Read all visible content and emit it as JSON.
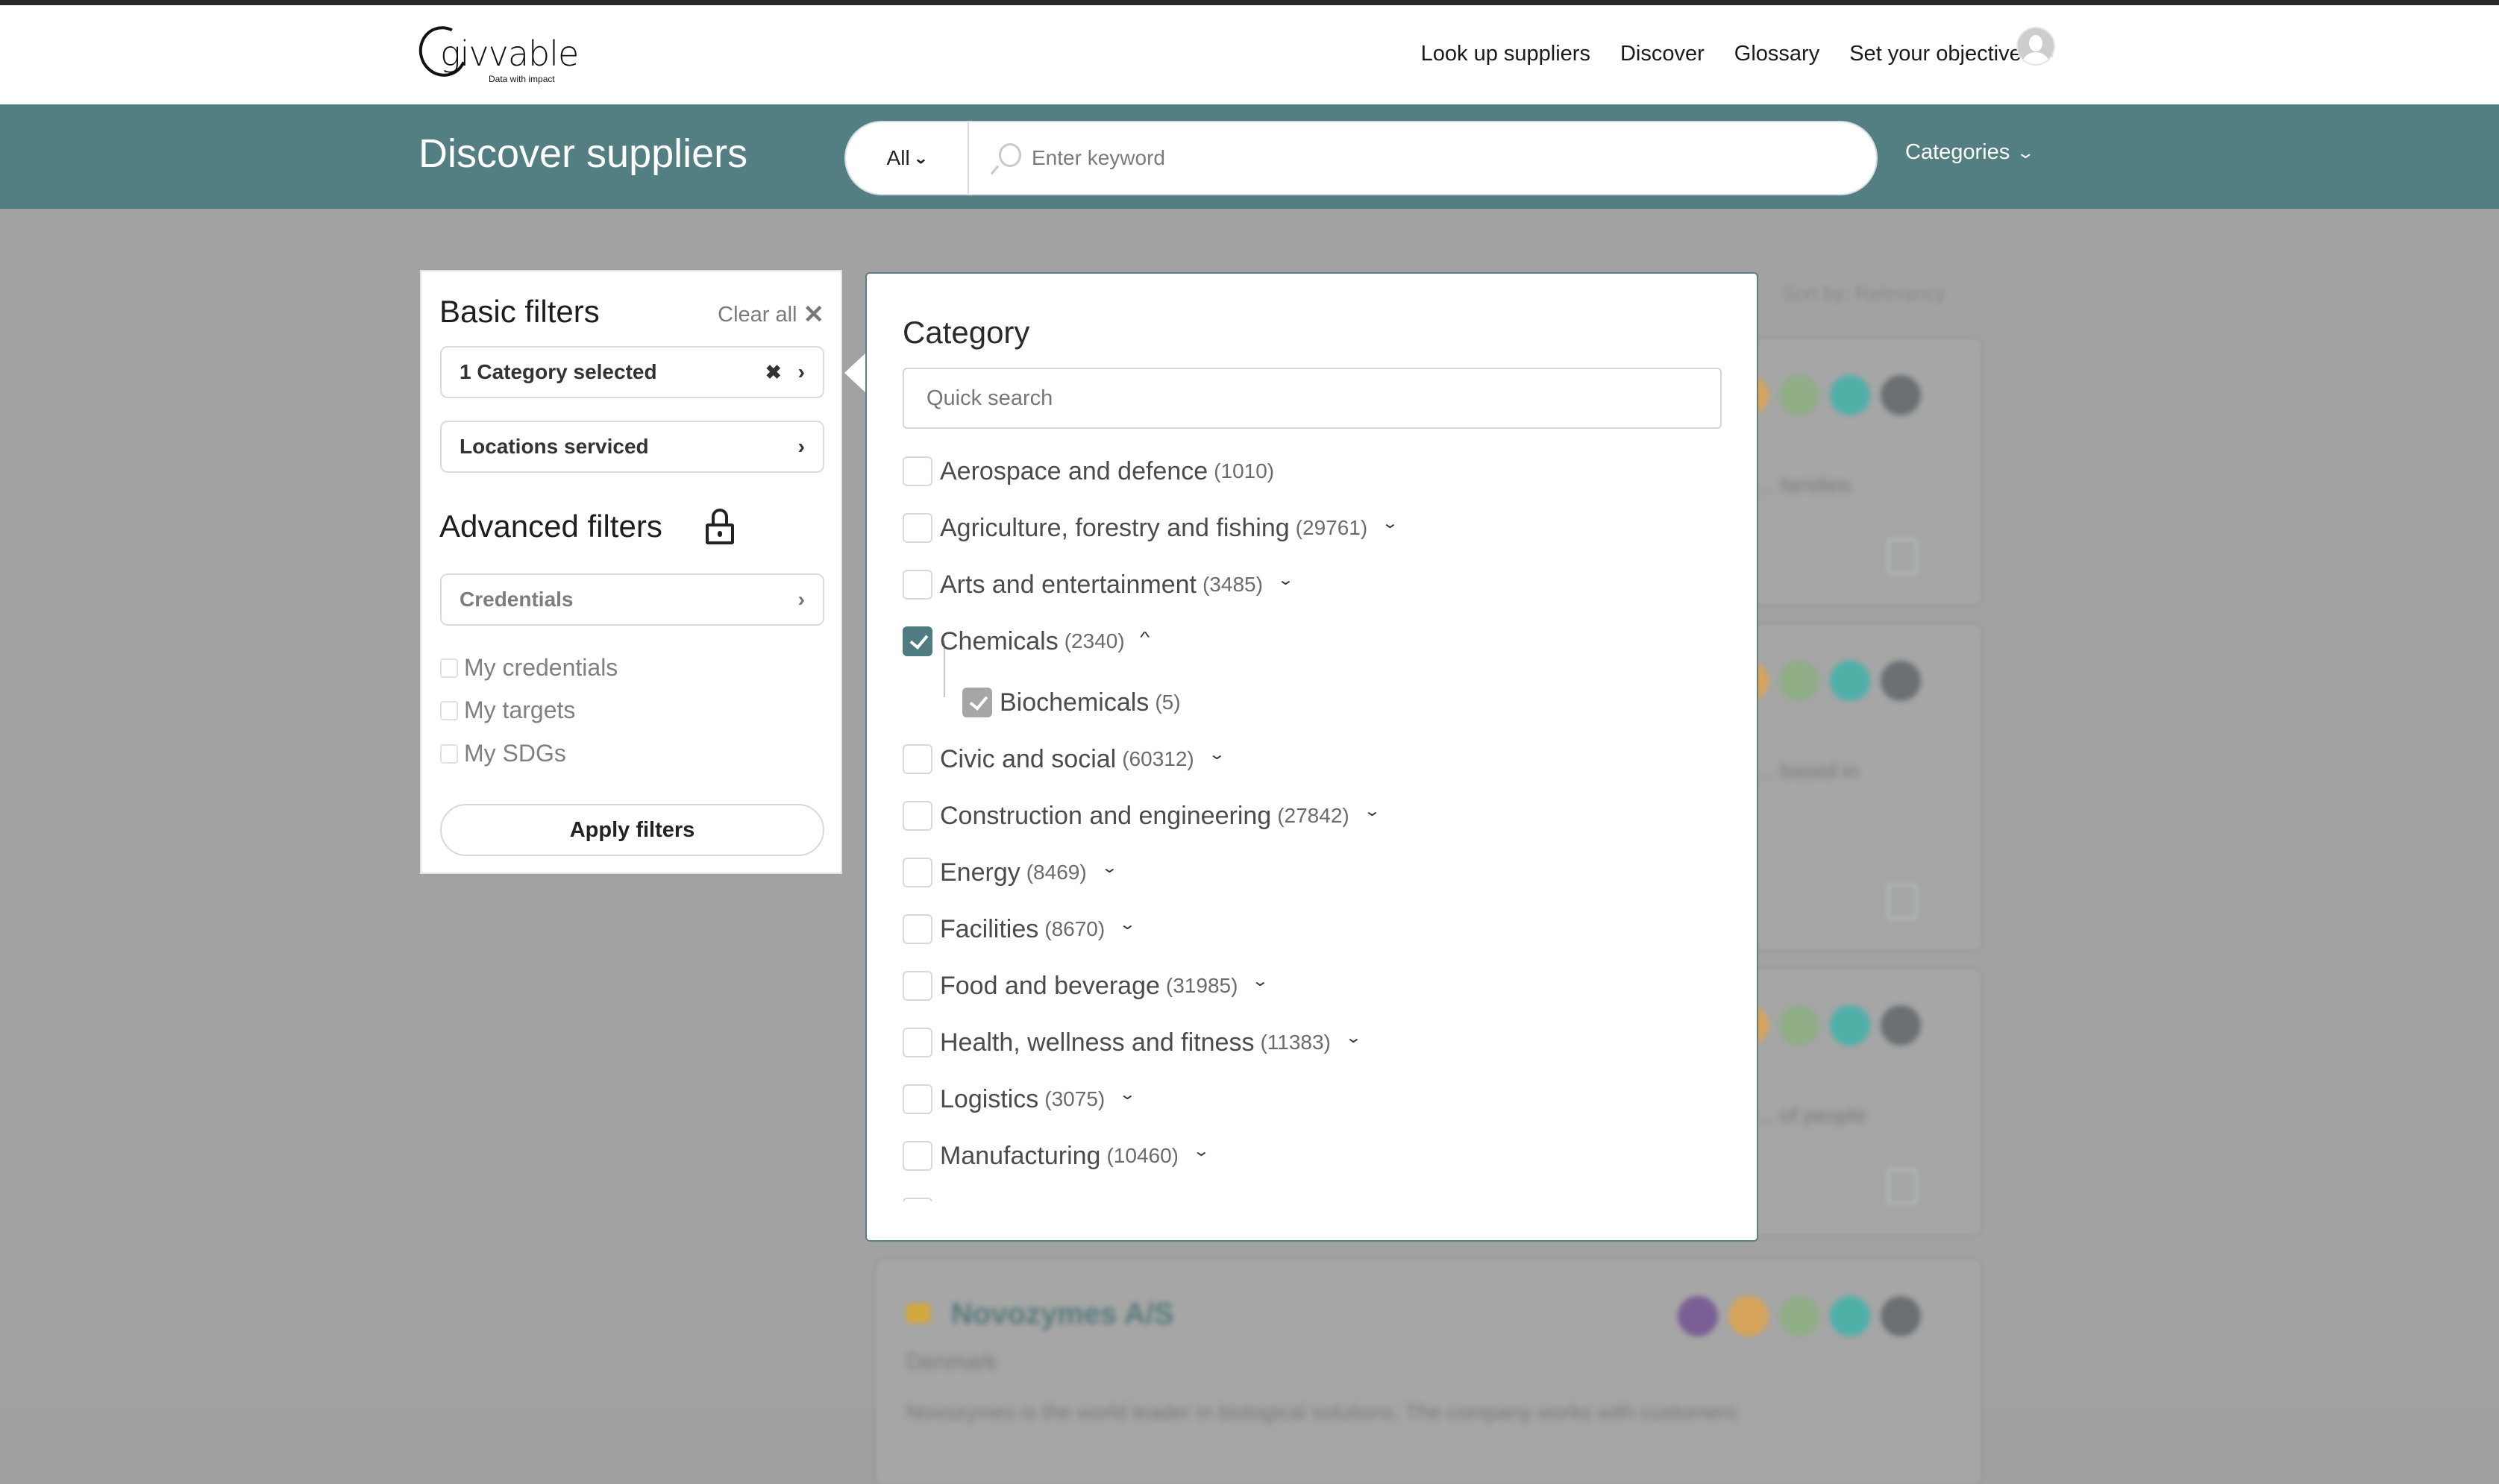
{
  "header": {
    "logo": {
      "wordmark": "givvable",
      "tagline": "Data with impact"
    },
    "nav": [
      {
        "label": "Look up suppliers"
      },
      {
        "label": "Discover"
      },
      {
        "label": "Glossary"
      },
      {
        "label": "Set your objectives",
        "icon": "chevron-down-icon"
      }
    ],
    "avatar_icon": "user-avatar-icon"
  },
  "band": {
    "title": "Discover suppliers",
    "search": {
      "scope_label": "All",
      "scope_icon": "chevron-down-icon",
      "search_icon": "search-icon",
      "placeholder": "Enter keyword",
      "value": ""
    },
    "categories_label": "Categories"
  },
  "filters": {
    "basic_title": "Basic filters",
    "clear_all_label": "Clear all",
    "category_button": "1 Category selected",
    "locations_button": "Locations serviced",
    "advanced_title": "Advanced filters",
    "credentials_button": "Credentials",
    "advanced_checks": [
      {
        "label": "My credentials",
        "checked": false
      },
      {
        "label": "My targets",
        "checked": false
      },
      {
        "label": "My SDGs",
        "checked": false
      }
    ],
    "apply_label": "Apply filters"
  },
  "category_popup": {
    "title": "Category",
    "search_placeholder": "Quick search",
    "search_value": "",
    "items": [
      {
        "name": "Aerospace and defence",
        "count": "(1010)",
        "checked": false,
        "expandable": false
      },
      {
        "name": "Agriculture, forestry and fishing",
        "count": "(29761)",
        "checked": false,
        "expandable": true,
        "expanded": false
      },
      {
        "name": "Arts and entertainment",
        "count": "(3485)",
        "checked": false,
        "expandable": true,
        "expanded": false
      },
      {
        "name": "Chemicals",
        "count": "(2340)",
        "checked": true,
        "expandable": true,
        "expanded": true,
        "children": [
          {
            "name": "Biochemicals",
            "count": "(5)",
            "checked": true
          }
        ]
      },
      {
        "name": "Civic and social",
        "count": "(60312)",
        "checked": false,
        "expandable": true,
        "expanded": false
      },
      {
        "name": "Construction and engineering",
        "count": "(27842)",
        "checked": false,
        "expandable": true,
        "expanded": false
      },
      {
        "name": "Energy",
        "count": "(8469)",
        "checked": false,
        "expandable": true,
        "expanded": false
      },
      {
        "name": "Facilities",
        "count": "(8670)",
        "checked": false,
        "expandable": true,
        "expanded": false
      },
      {
        "name": "Food and beverage",
        "count": "(31985)",
        "checked": false,
        "expandable": true,
        "expanded": false
      },
      {
        "name": "Health, wellness and fitness",
        "count": "(11383)",
        "checked": false,
        "expandable": true,
        "expanded": false
      },
      {
        "name": "Logistics",
        "count": "(3075)",
        "checked": false,
        "expandable": true,
        "expanded": false
      },
      {
        "name": "Manufacturing",
        "count": "(10460)",
        "checked": false,
        "expandable": true,
        "expanded": false
      }
    ]
  },
  "background": {
    "sort_label": "Sort by: Relevancy",
    "cards": [
      {
        "name": "",
        "desc": "... families"
      },
      {
        "name": "",
        "desc": "... based in"
      },
      {
        "name": "",
        "desc": "... of people"
      },
      {
        "name": "Novozymes A/S",
        "country": "Denmark",
        "desc": "Novozymes is the world leader in biological solutions. The company works with customers"
      }
    ],
    "sdg_colors": [
      "#7a5f94",
      "#d6a45a",
      "#8fae86",
      "#4fb0a8",
      "#6b6f72"
    ]
  },
  "colors": {
    "brand_teal": "#537f82",
    "checkbox_checked": "#4f7c80",
    "checkbox_sub_checked": "#a6a6a6",
    "overlay_gray": "#a2a2a2"
  }
}
